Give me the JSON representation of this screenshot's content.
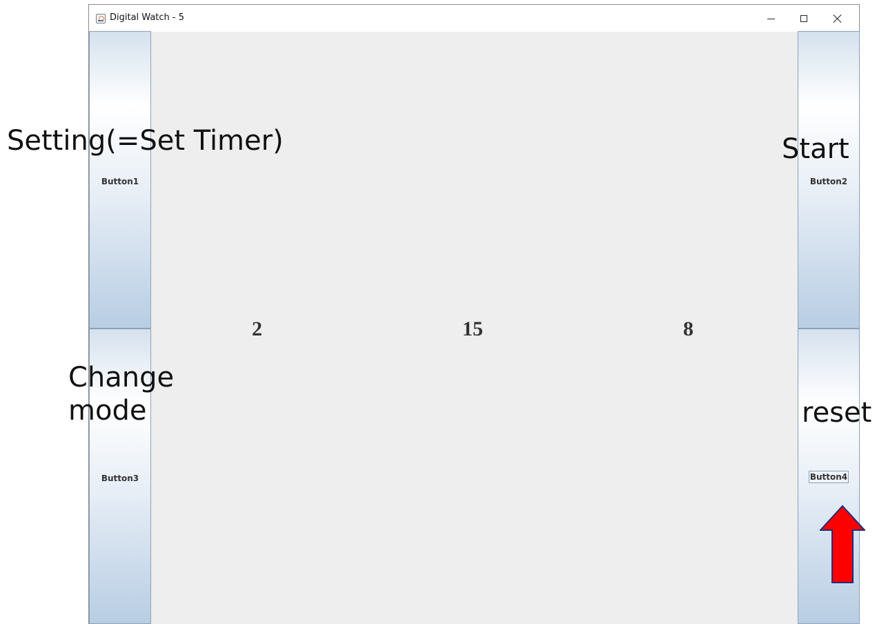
{
  "window": {
    "title": "Digital Watch - 5",
    "controls": {
      "minimize": "minimize-icon",
      "maximize": "maximize-icon",
      "close": "close-icon"
    }
  },
  "buttons": {
    "button1": "Button1",
    "button2": "Button2",
    "button3": "Button3",
    "button4": "Button4"
  },
  "display": {
    "hours": "2",
    "minutes": "15",
    "seconds": "8"
  },
  "annotations": {
    "setting": "Setting(=Set Timer)",
    "start": "Start",
    "change_line1": "Change",
    "change_line2": "mode",
    "reset": "reset"
  },
  "colors": {
    "arrow": "#ff0000",
    "arrow_outline": "#1f2f7a",
    "panel": "#eeeeee"
  }
}
